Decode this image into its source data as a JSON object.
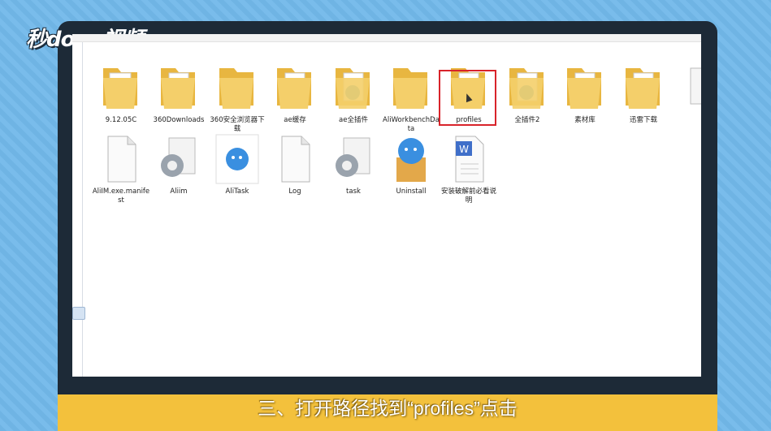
{
  "brand": {
    "logo_text": "秒dong视频"
  },
  "folders": [
    {
      "label": "9.12.05C"
    },
    {
      "label": "360Downloads"
    },
    {
      "label": "360安全浏览器下载"
    },
    {
      "label": "ae缓存"
    },
    {
      "label": "ae全插件"
    },
    {
      "label": "AliWorkbenchData"
    },
    {
      "label": "profiles"
    },
    {
      "label": "全插件2"
    },
    {
      "label": "素材库"
    },
    {
      "label": "迅雷下载"
    }
  ],
  "files": [
    {
      "label": "AliIM.exe.manifest"
    },
    {
      "label": "Aliim"
    },
    {
      "label": "AliTask"
    },
    {
      "label": "Log"
    },
    {
      "label": "task"
    },
    {
      "label": "Uninstall"
    },
    {
      "label": "安装破解前必看说明"
    }
  ],
  "subtitle": "三、打开路径找到“profiles”点击",
  "colors": {
    "folder": "#f0c65a",
    "highlight": "#d8232a",
    "subtitle_bar": "#f3c13c"
  }
}
